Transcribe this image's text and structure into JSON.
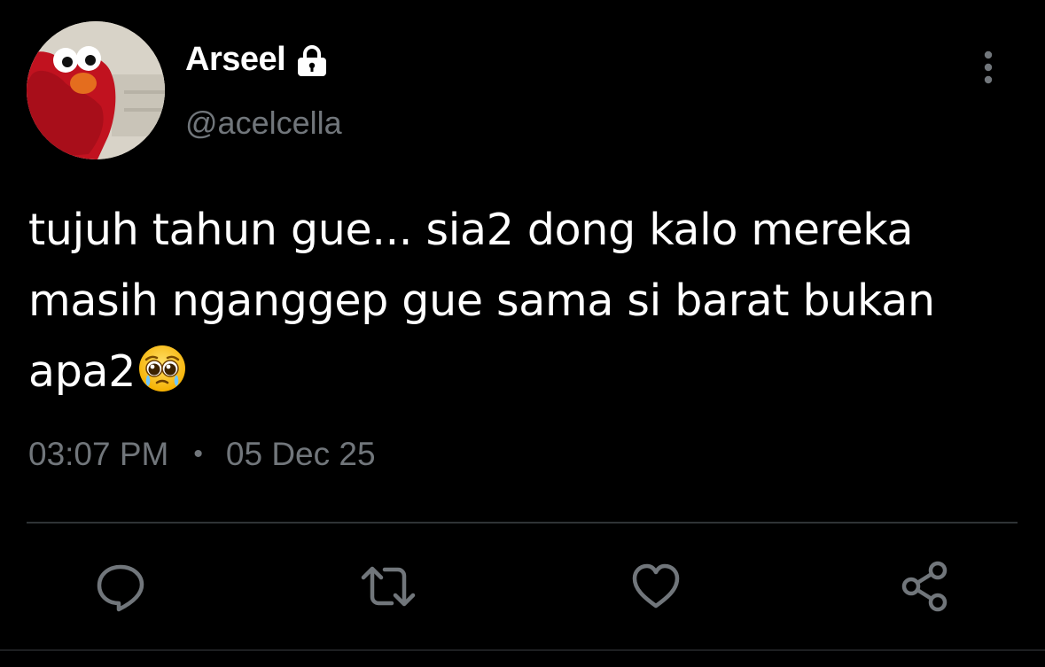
{
  "user": {
    "display_name": "Arseel",
    "handle": "@acelcella",
    "protected_icon": "lock-icon",
    "avatar_description_icon": "elmo-avatar"
  },
  "tweet": {
    "lines": [
      "tujuh tahun gue... sia2 dong kalo mereka",
      "masih nganggep gue sama si barat bukan",
      "apa2"
    ],
    "emoji": "🥹",
    "time": "03:07 PM",
    "separator": "•",
    "date": "05 Dec 25"
  },
  "actions": [
    {
      "name": "reply",
      "icon": "reply-icon"
    },
    {
      "name": "retweet",
      "icon": "retweet-icon"
    },
    {
      "name": "like",
      "icon": "heart-icon"
    },
    {
      "name": "share",
      "icon": "share-icon"
    }
  ],
  "colors": {
    "background": "#000000",
    "text_primary": "#ffffff",
    "text_secondary": "#71767b",
    "divider": "#2f3336",
    "icon": "#71767b"
  }
}
